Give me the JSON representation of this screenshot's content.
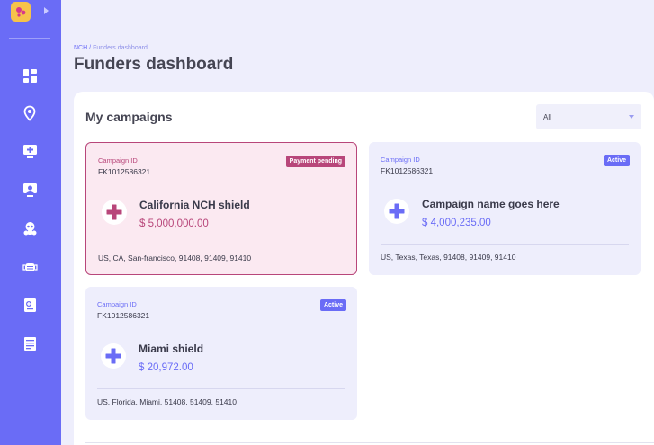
{
  "breadcrumb": {
    "root": "NCH",
    "separator": "/",
    "current": "Funders dashboard"
  },
  "page_title": "Funders dashboard",
  "panel": {
    "title": "My campaigns",
    "filter": {
      "selected": "All"
    }
  },
  "sidebar": {
    "logo_icon": "app-logo-icon",
    "items": [
      {
        "icon": "dashboard-grid-icon"
      },
      {
        "icon": "location-pin-icon"
      },
      {
        "icon": "medical-monitor-icon"
      },
      {
        "icon": "support-screen-icon"
      },
      {
        "icon": "hazmat-mask-icon"
      },
      {
        "icon": "face-mask-icon"
      },
      {
        "icon": "medical-report-icon"
      },
      {
        "icon": "document-list-icon"
      }
    ]
  },
  "campaigns": [
    {
      "id_label": "Campaign ID",
      "id": "FK1012586321",
      "status": "Payment pending",
      "name": "California NCH shield",
      "amount": "$ 5,000,000.00",
      "location": "US, CA, San-francisco, 91408, 91409, 91410"
    },
    {
      "id_label": "Campaign ID",
      "id": "FK1012586321",
      "status": "Active",
      "name": "Campaign name goes here",
      "amount": "$ 4,000,235.00",
      "location": "US, Texas, Texas, 91408, 91409, 91410"
    },
    {
      "id_label": "Campaign ID",
      "id": "FK1012586321",
      "status": "Active",
      "name": "Miami shield",
      "amount": "$ 20,972.00",
      "location": "US, Florida, Miami, 51408, 51409, 51410"
    }
  ],
  "colors": {
    "sidebar": "#6a6cf6",
    "accent_blue": "#6a6cf6",
    "accent_pink": "#b8467a",
    "card_bg": "#eeeefc",
    "pending_bg": "#fbe9f1"
  }
}
